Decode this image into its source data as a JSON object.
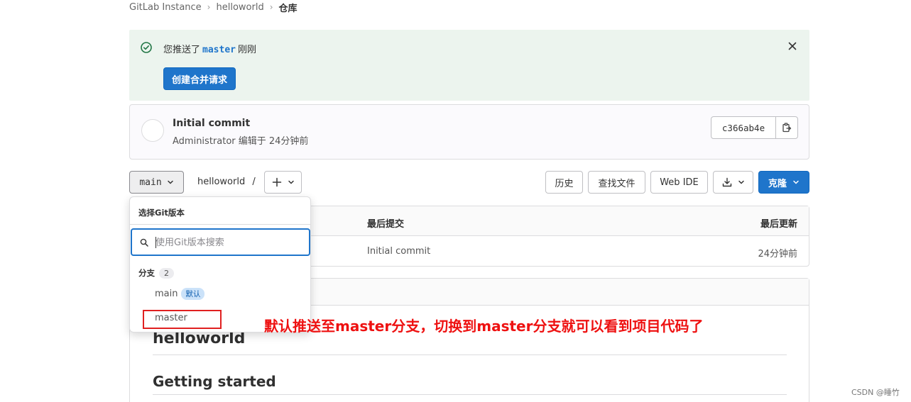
{
  "breadcrumb": {
    "root": "GitLab Instance",
    "project": "helloworld",
    "current": "仓库"
  },
  "alert": {
    "prefix": "您推送了",
    "branch": "master",
    "suffix": "刚刚",
    "button": "创建合并请求"
  },
  "commit": {
    "title": "Initial commit",
    "meta": "Administrator 编辑于 24分钟前",
    "sha": "c366ab4e"
  },
  "toolbar": {
    "ref": "main",
    "path": "helloworld",
    "path_sep": "/",
    "history": "历史",
    "find_file": "查找文件",
    "web_ide": "Web IDE",
    "clone": "克隆"
  },
  "files": {
    "col_last_commit": "最后提交",
    "col_last_update": "最后更新",
    "row_commit": "Initial commit",
    "row_update": "24分钟前"
  },
  "readme": {
    "h1": "helloworld",
    "h2": "Getting started"
  },
  "dropdown": {
    "title": "选择Git版本",
    "search_placeholder": "使用Git版本搜索",
    "section": "分支",
    "section_count": "2",
    "items": [
      {
        "label": "main",
        "badge": "默认"
      },
      {
        "label": "master"
      }
    ]
  },
  "annotation": "默认推送至master分支，切换到master分支就可以看到项目代码了",
  "watermark": "CSDN @睡竹",
  "colors": {
    "primary": "#1f75cb",
    "success_bg": "#ecf4ee",
    "annotation": "#ee1111"
  }
}
